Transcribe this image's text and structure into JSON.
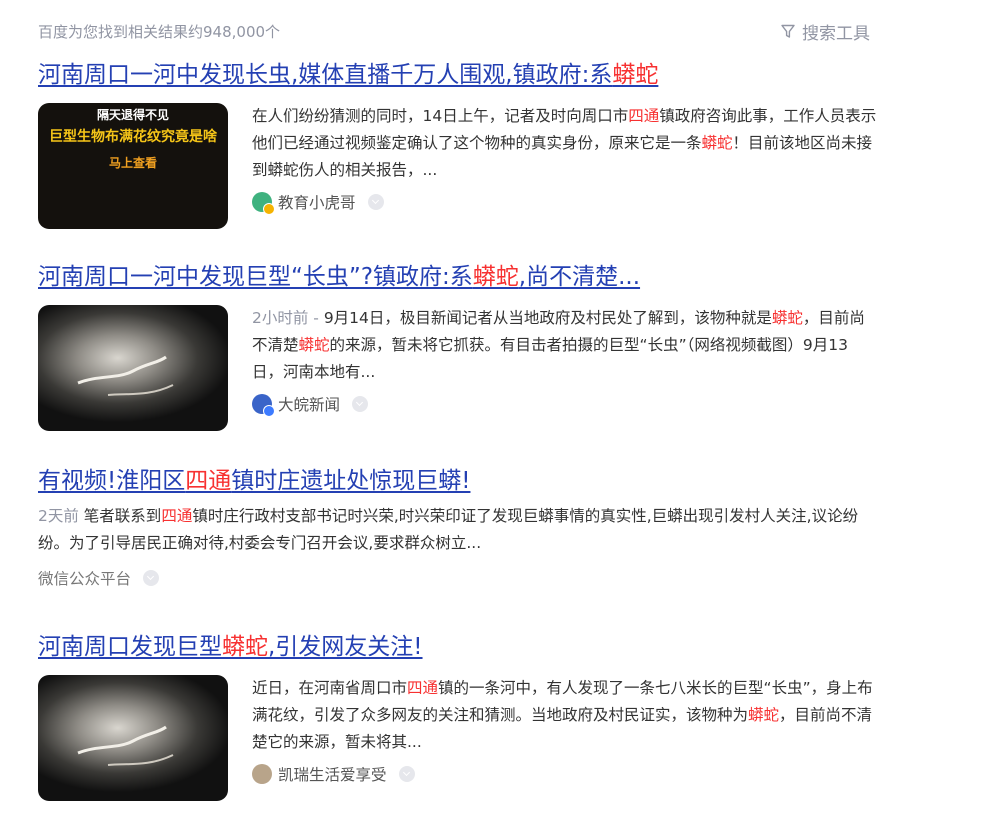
{
  "header": {
    "result_count": "百度为您找到相关结果约948,000个",
    "tools_label": "搜索工具",
    "tools_icon": "filter-icon"
  },
  "results": [
    {
      "title": [
        "河南周口一河中发现长虫,媒体直播千万人围观,镇政府:系",
        "蟒蛇"
      ],
      "thumb_text": [
        "隔天退得不见",
        "巨型生物布满花纹究竟是啥",
        "马上查看"
      ],
      "abstract": [
        "在人们纷纷猜测的同时，14日上午，记者及时向周口市",
        "四通",
        "镇政府咨询此事，工作人员表示他们已经通过视频鉴定确认了这个物种的真实身份，原来它是一条",
        "蟒蛇",
        "！目前该地区尚未接到蟒蛇伤人的相关报告，..."
      ],
      "source": "教育小虎哥"
    },
    {
      "title": [
        "河南周口一河中发现巨型“长虫”?镇政府:系",
        "蟒蛇",
        ",尚不清楚..."
      ],
      "time": "2小时前 - ",
      "abstract": [
        "9月14日，极目新闻记者从当地政府及村民处了解到，该物种就是",
        "蟒蛇",
        "，目前尚不清楚",
        "蟒蛇",
        "的来源，暂未将它抓获。有目击者拍摄的巨型“长虫”（网络视频截图）9月13日，河南本地有..."
      ],
      "source": "大皖新闻"
    },
    {
      "title": [
        "有视频!淮阳区",
        "四通",
        "镇时庄遗址处惊现巨蟒!"
      ],
      "time": "2天前 ",
      "abstract": [
        "笔者联系到",
        "四通",
        "镇时庄行政村支部书记时兴荣,时兴荣印证了发现巨蟒事情的真实性,巨蟒出现引发村人关注,议论纷纷。为了引导居民正确对待,村委会专门召开会议,要求群众树立..."
      ],
      "source": "微信公众平台"
    },
    {
      "title": [
        "河南周口发现巨型",
        "蟒蛇",
        ",引发网友关注!"
      ],
      "abstract": [
        "近日，在河南省周口市",
        "四通",
        "镇的一条河中，有人发现了一条七八米长的巨型“长虫”，身上布满花纹，引发了众多网友的关注和猜测。当地政府及村民证实，该物种为",
        "蟒蛇",
        "，目前尚不清楚它的来源，暂未将其..."
      ],
      "source": "凯瑞生活爱享受"
    }
  ],
  "colors": {
    "link": "#2440b3",
    "highlight": "#f73131",
    "meta": "#9195a3"
  }
}
